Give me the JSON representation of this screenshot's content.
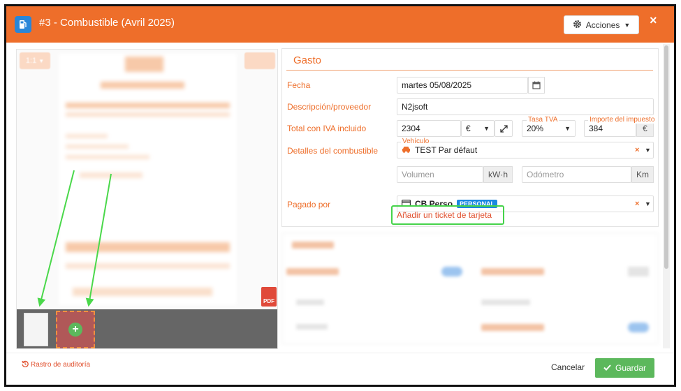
{
  "header": {
    "title": "#3 -  Combustible (Avril 2025)",
    "actions_label": "Acciones",
    "close_symbol": "×",
    "color": "#ee6e2a",
    "fuel_badge_color": "#2a86d8"
  },
  "preview": {
    "ratio_label": "1:1",
    "pdf_label": "PDF",
    "add_symbol": "+"
  },
  "form": {
    "section_title": "Gasto",
    "fecha_label": "Fecha",
    "fecha_value": "martes 05/08/2025",
    "descripcion_label": "Descripción/proveedor",
    "descripcion_value": "N2jsoft",
    "total_label": "Total con IVA incluido",
    "total_value": "2304",
    "currency": "€",
    "tasa_label": "Tasa TVA",
    "tasa_value": "20%",
    "importe_label": "Importe del impuesto",
    "importe_value": "384",
    "importe_currency": "€",
    "combustible_label": "Detalles del combustible",
    "vehiculo_label": "Vehículo",
    "vehiculo_value": "TEST Par défaut",
    "volumen_placeholder": "Volumen",
    "volumen_unit": "kW·h",
    "odometro_placeholder": "Odómetro",
    "odometro_unit": "Km",
    "pagado_label": "Pagado por",
    "pagado_value": "CB Perso",
    "pagado_badge": "PERSONAL",
    "add_ticket_link": "Añadir un ticket de tarjeta"
  },
  "footer": {
    "audit_label": "Rastro de auditoría",
    "cancel_label": "Cancelar",
    "save_label": "Guardar"
  },
  "colors": {
    "accent": "#ee6e2a",
    "save_green": "#5cb85c",
    "highlight_green": "#45d34a",
    "badge_blue": "#1a88e0"
  }
}
